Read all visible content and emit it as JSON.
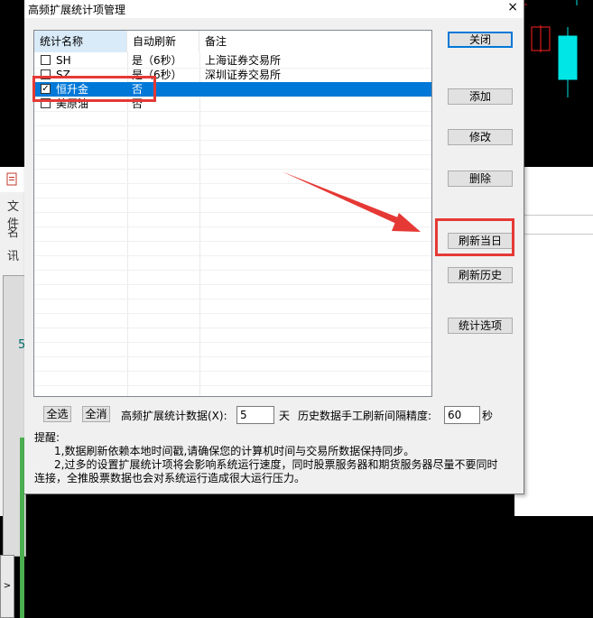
{
  "dialog": {
    "title": "高频扩展统计项管理",
    "close_glyph": "×"
  },
  "list": {
    "headers": [
      "统计名称",
      "自动刷新",
      "备注"
    ],
    "rows": [
      {
        "checked": false,
        "name": "SH",
        "auto": "是（6秒）",
        "note": "上海证券交易所",
        "selected": false
      },
      {
        "checked": false,
        "name": "SZ",
        "auto": "是（6秒）",
        "note": "深圳证券交易所",
        "selected": false
      },
      {
        "checked": true,
        "name": "恒升金",
        "auto": "否",
        "note": "",
        "selected": true
      },
      {
        "checked": false,
        "name": "美原油",
        "auto": "否",
        "note": "",
        "selected": false
      }
    ]
  },
  "buttons": {
    "close": "关闭",
    "add": "添加",
    "edit": "修改",
    "delete": "删除",
    "refresh_today": "刷新当日",
    "refresh_history": "刷新历史",
    "stat_options": "统计选项",
    "select_all": "全选",
    "deselect_all": "全消"
  },
  "bottom": {
    "days_label": "高频扩展统计数据(X):",
    "days_value": "5",
    "days_unit": "天",
    "interval_label": "历史数据手工刷新间隔精度:",
    "interval_value": "60",
    "interval_unit": "秒"
  },
  "notes": {
    "title": "提醒:",
    "line1": "1,数据刷新依赖本地时间戳,请确保您的计算机时间与交易所数据保持同步。",
    "line2": "2,过多的设置扩展统计项将会影响系统运行速度，同时股票服务器和期货服务器尽量不要同时",
    "line3": "连接，全推股票数据也会对系统运行造成很大运行压力。"
  },
  "background": {
    "left_labels": [
      "文件",
      "名",
      "讯",
      "5"
    ],
    "tab_glyph": ">"
  },
  "colors": {
    "selection": "#0078d7",
    "annotation": "#e53935",
    "candle_up": "#ff2020",
    "candle_cyan": "#00e5e5"
  }
}
